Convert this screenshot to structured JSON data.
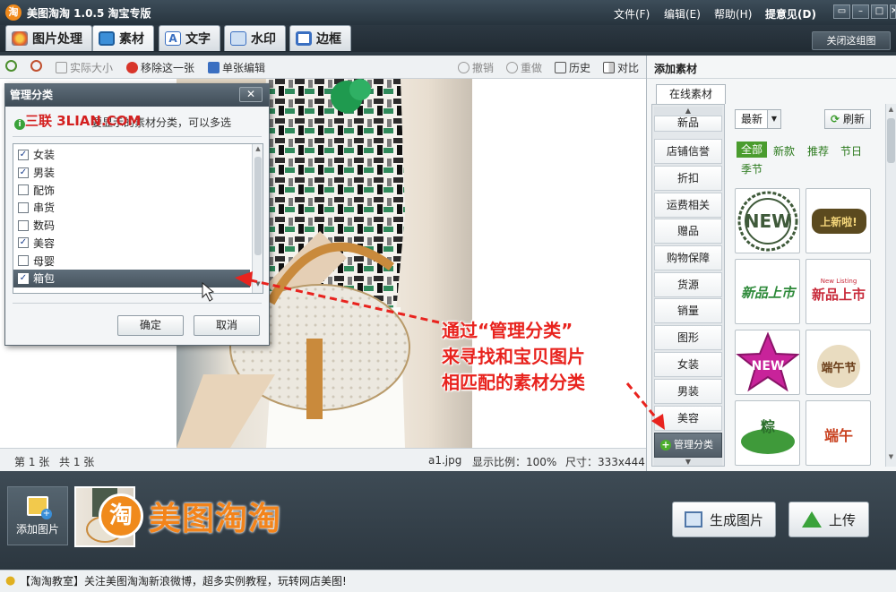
{
  "window": {
    "title": "美图淘淘 1.0.5 淘宝专版",
    "logo_char": "淘",
    "menus": [
      "文件(F)",
      "编辑(E)",
      "帮助(H)",
      "提意见(D)"
    ],
    "win_buttons": [
      "▭",
      "–",
      "□",
      "✕"
    ]
  },
  "tabs": [
    {
      "label": "图片处理",
      "color": "#e8a33b"
    },
    {
      "label": "素材",
      "color": "#3c8fd8"
    },
    {
      "label": "文字",
      "color": "#3a6fc1"
    },
    {
      "label": "水印",
      "color": "#3a6fc1"
    },
    {
      "label": "边框",
      "color": "#3a6fc1"
    }
  ],
  "close_group": "关闭这组图",
  "toolbar": {
    "actual_size": "实际大小",
    "remove_one": "移除这一张",
    "single_edit": "单张编辑",
    "undo": "撤销",
    "redo": "重做",
    "history": "历史",
    "compare": "对比"
  },
  "status": {
    "page": "第 1 张",
    "total": "共 1 张",
    "file": "a1.jpg",
    "ratio": "显示比例：100%",
    "size": "尺寸：333x444"
  },
  "right_panel": {
    "header": "添加素材",
    "online_tab": "在线素材",
    "categories": [
      "新品",
      "店铺信誉",
      "折扣",
      "运费相关",
      "赠品",
      "购物保障",
      "货源",
      "销量",
      "图形",
      "女装",
      "男装",
      "美容"
    ],
    "manage": "管理分类",
    "sort_value": "最新",
    "refresh": "刷新",
    "filters": [
      "全部",
      "新款",
      "推荐",
      "节日",
      "季节"
    ],
    "thumbs": [
      {
        "text": "NEW"
      },
      {
        "text": "上新啦!"
      },
      {
        "text": "新品上市"
      },
      {
        "text": "新品上市",
        "sub": "New Listing"
      },
      {
        "text": "NEW"
      },
      {
        "text": "端午节"
      },
      {
        "text": "粽"
      },
      {
        "text": "端午"
      }
    ]
  },
  "bottom": {
    "add_image": "添加图片",
    "brand": "美图淘淘",
    "brand_logo": "淘",
    "generate": "生成图片",
    "upload": "上传"
  },
  "tip": "【淘淘教室】关注美图淘淘新浪微博，超多实例教程，玩转网店美图!",
  "dialog": {
    "title": "管理分类",
    "close": "✕",
    "tip": "要显示的素材分类，可以多选",
    "watermark": "三联 3LIAN.COM",
    "items": [
      {
        "label": "女装",
        "checked": true
      },
      {
        "label": "男装",
        "checked": true
      },
      {
        "label": "配饰",
        "checked": false
      },
      {
        "label": "串货",
        "checked": false
      },
      {
        "label": "数码",
        "checked": false
      },
      {
        "label": "美容",
        "checked": true
      },
      {
        "label": "母婴",
        "checked": false
      },
      {
        "label": "箱包",
        "checked": true
      }
    ],
    "ok": "确定",
    "cancel": "取消"
  },
  "annotation": [
    "通过“管理分类”",
    "来寻找和宝贝图片",
    "相匹配的素材分类"
  ]
}
